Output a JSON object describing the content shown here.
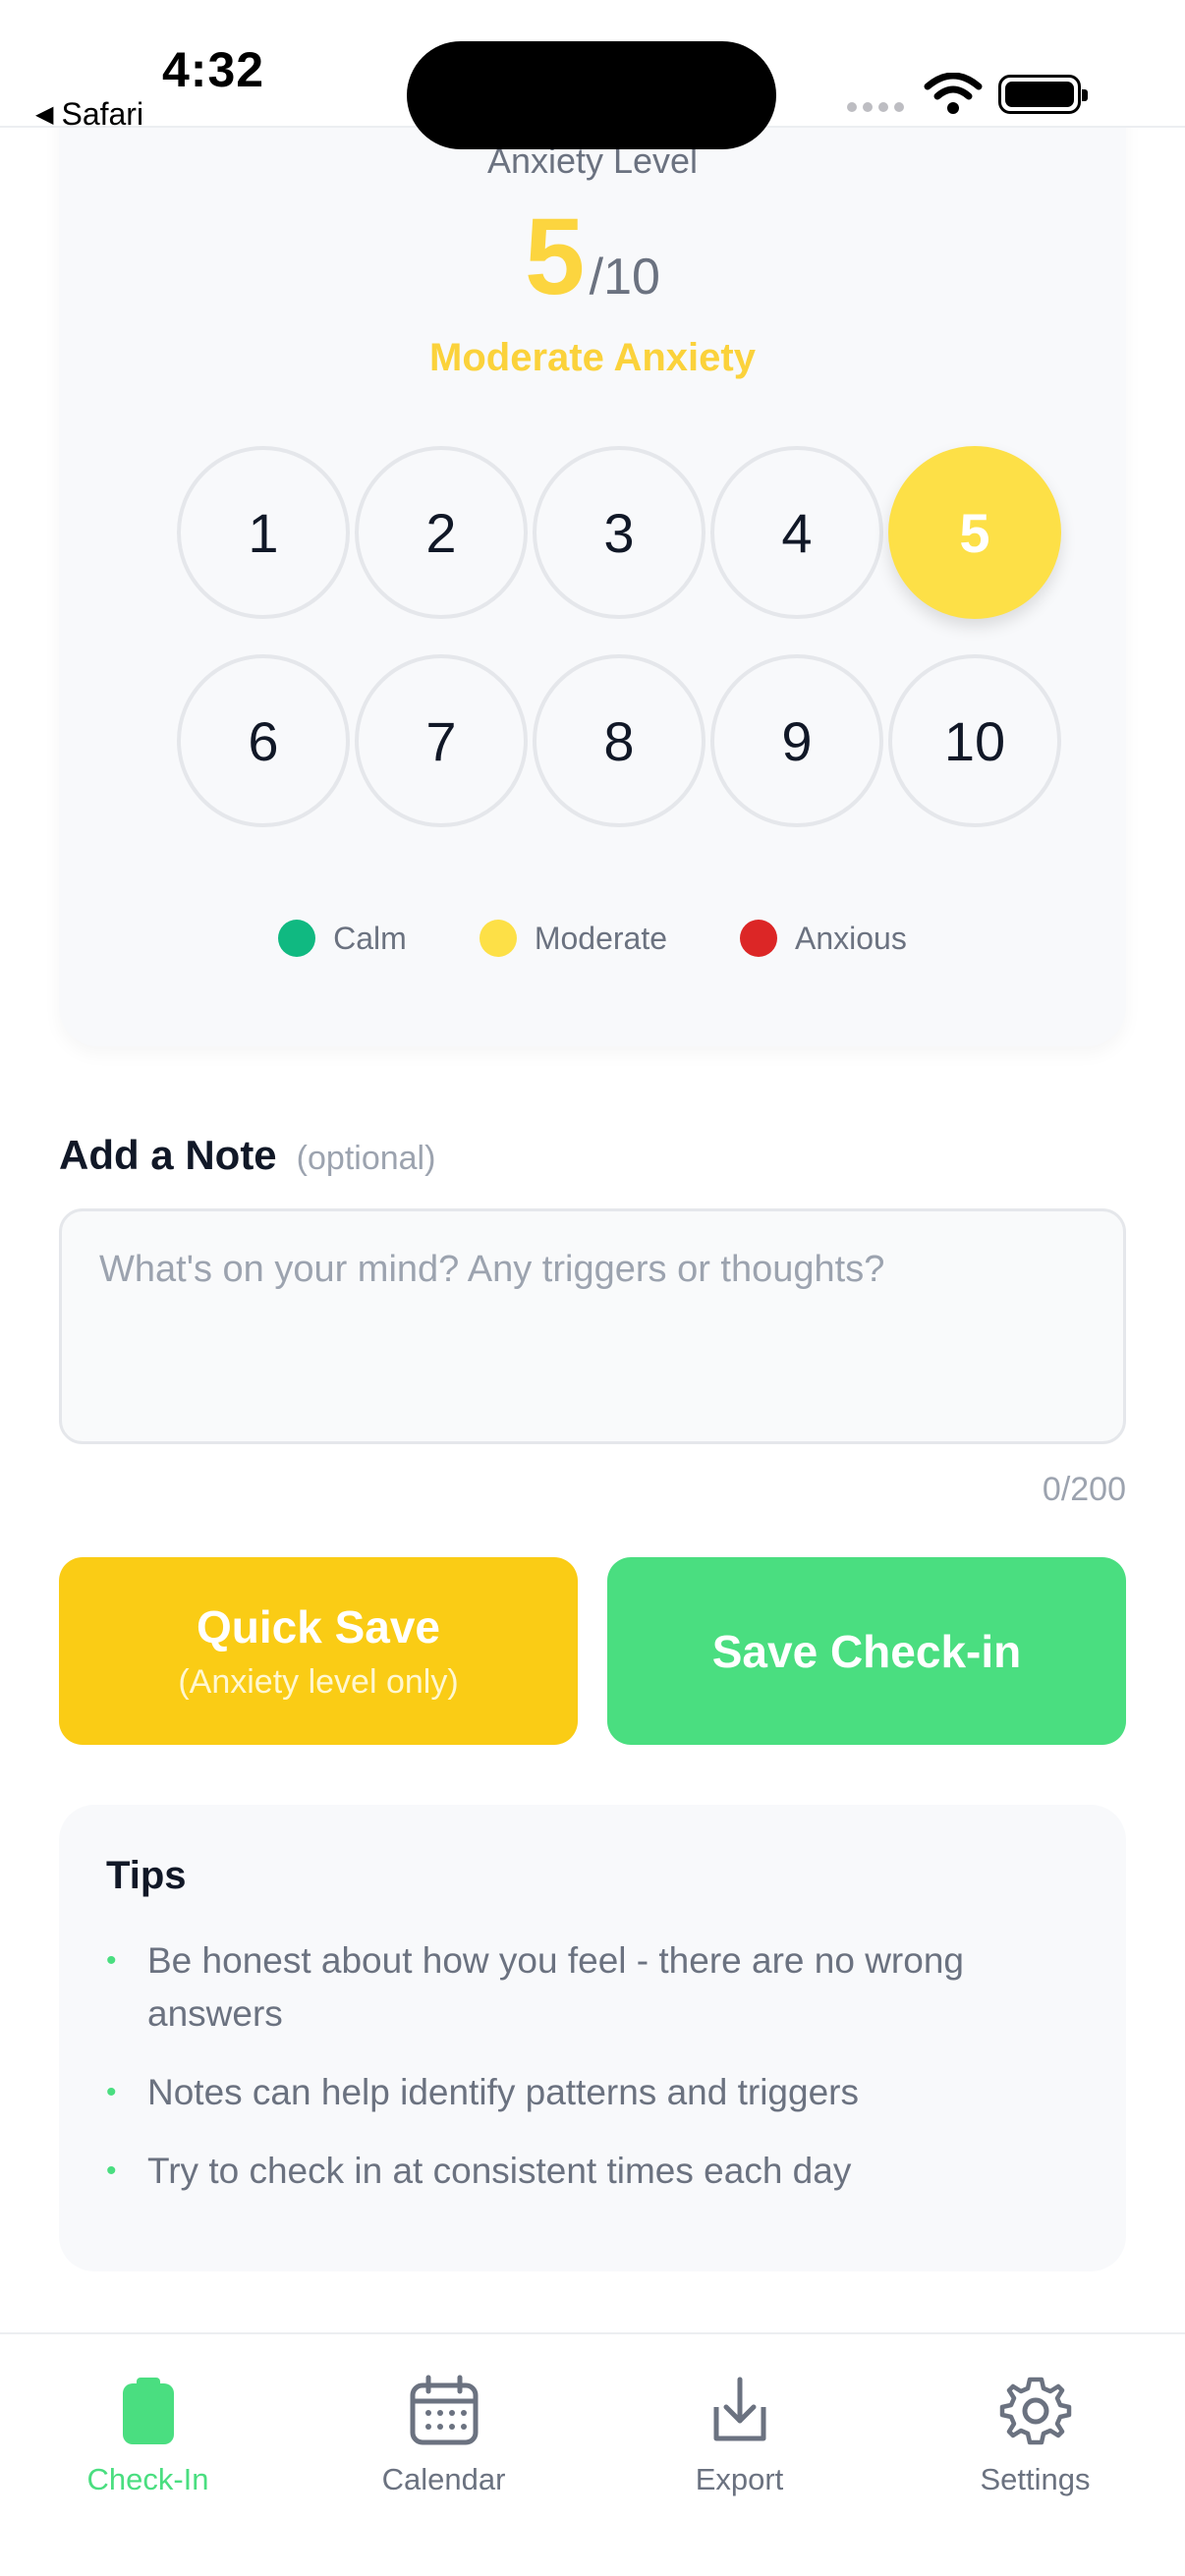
{
  "status_bar": {
    "time": "4:32",
    "back_label": "Safari"
  },
  "anxiety": {
    "title": "Anxiety Level",
    "value": "5",
    "max": "/10",
    "label": "Moderate Anxiety",
    "scale": [
      "1",
      "2",
      "3",
      "4",
      "5",
      "6",
      "7",
      "8",
      "9",
      "10"
    ],
    "selected": "5",
    "legend": [
      {
        "label": "Calm",
        "color": "#10b981"
      },
      {
        "label": "Moderate",
        "color": "#fde047"
      },
      {
        "label": "Anxious",
        "color": "#dc2626"
      }
    ]
  },
  "note": {
    "title": "Add a Note",
    "optional": "(optional)",
    "placeholder": "What's on your mind? Any triggers or thoughts?",
    "value": "",
    "char_count": "0/200"
  },
  "actions": {
    "quick_save": "Quick Save",
    "quick_save_sub": "(Anxiety level only)",
    "save_checkin": "Save Check-in"
  },
  "tips": {
    "title": "Tips",
    "items": [
      "Be honest about how you feel - there are no wrong answers",
      "Notes can help identify patterns and triggers",
      "Try to check in at consistent times each day"
    ]
  },
  "nav": {
    "items": [
      {
        "label": "Check-In",
        "icon": "clipboard-icon",
        "active": true
      },
      {
        "label": "Calendar",
        "icon": "calendar-icon",
        "active": false
      },
      {
        "label": "Export",
        "icon": "download-icon",
        "active": false
      },
      {
        "label": "Settings",
        "icon": "gear-icon",
        "active": false
      }
    ]
  },
  "colors": {
    "accent_green": "#4ade80",
    "accent_yellow": "#facc15",
    "selected_level": "#fde047"
  }
}
